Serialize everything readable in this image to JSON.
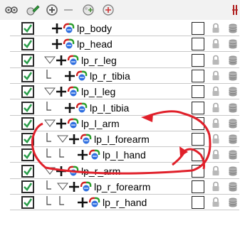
{
  "toolbar": {
    "icons": [
      "view-icon",
      "edit-icon",
      "add-icon",
      "collapse-icon",
      "add-node-icon",
      "add-group-icon"
    ]
  },
  "layers": [
    {
      "label": "lp_body",
      "indent": 0,
      "expand": false
    },
    {
      "label": "lp_head",
      "indent": 0,
      "expand": false
    },
    {
      "label": "lp_r_leg",
      "indent": 0,
      "expand": true
    },
    {
      "label": "lp_r_tibia",
      "indent": 1,
      "expand": false
    },
    {
      "label": "lp_l_leg",
      "indent": 0,
      "expand": true
    },
    {
      "label": "lp_l_tibia",
      "indent": 1,
      "expand": false
    },
    {
      "label": "lp_l_arm",
      "indent": 0,
      "expand": true
    },
    {
      "label": "lp_l_forearm",
      "indent": 1,
      "expand": true
    },
    {
      "label": "lp_l_hand",
      "indent": 2,
      "expand": false
    },
    {
      "label": "lp_r_arm",
      "indent": 0,
      "expand": true
    },
    {
      "label": "lp_r_forearm",
      "indent": 1,
      "expand": true
    },
    {
      "label": "lp_r_hand",
      "indent": 2,
      "expand": false
    }
  ],
  "annotation_color": "#e0202a"
}
